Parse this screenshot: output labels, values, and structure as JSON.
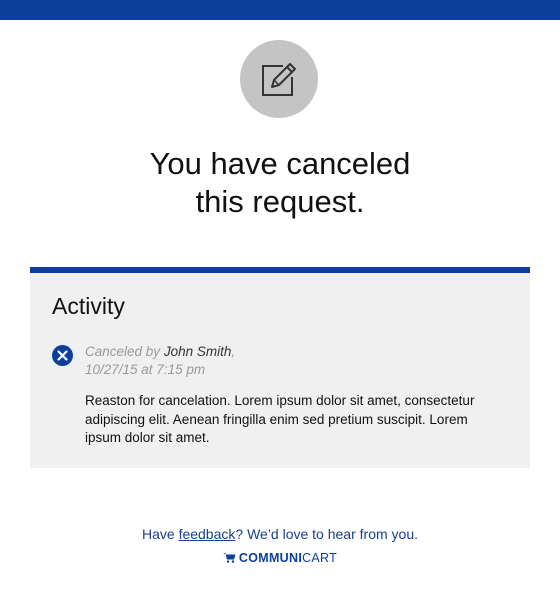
{
  "colors": {
    "brand_blue": "#0c3f9c",
    "panel_bg": "#f0f0f0",
    "badge_gray": "#c4c4c4"
  },
  "header": {
    "icon": "edit-icon"
  },
  "headline": {
    "line1": "You have canceled",
    "line2": "this request."
  },
  "activity": {
    "title": "Activity",
    "entry": {
      "status_icon": "close-circle-icon",
      "action": "Canceled by",
      "user": "John Smith",
      "separator": ",",
      "timestamp": "10/27/15 at 7:15 pm",
      "reason": "Reaston for cancelation. Lorem ipsum dolor sit amet, consectetur adipiscing elit. Aenean fringilla enim sed pretium suscipit. Lorem ipsum dolor sit amet."
    }
  },
  "footer": {
    "prefix": "Have ",
    "link": "feedback",
    "suffix": "? We’d love to hear from you.",
    "brand_bold": "COMMUNI",
    "brand_light": "CART",
    "brand_icon": "cart-icon"
  }
}
